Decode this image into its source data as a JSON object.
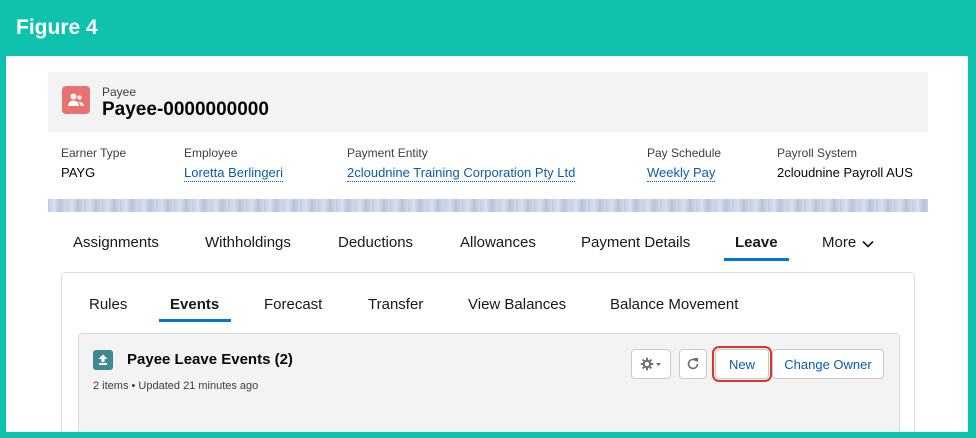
{
  "figure": {
    "title": "Figure 4"
  },
  "record": {
    "object_type": "Payee",
    "name": "Payee-0000000000",
    "icon": "payee-icon"
  },
  "highlights": [
    {
      "label": "Earner Type",
      "value": "PAYG",
      "link": false
    },
    {
      "label": "Employee",
      "value": "Loretta Berlingeri",
      "link": true
    },
    {
      "label": "Payment Entity",
      "value": "2cloudnine Training Corporation Pty Ltd",
      "link": true
    },
    {
      "label": "Pay Schedule",
      "value": "Weekly Pay",
      "link": true
    },
    {
      "label": "Payroll System",
      "value": "2cloudnine Payroll AUS",
      "link": false
    }
  ],
  "main_tabs": {
    "items": [
      "Assignments",
      "Withholdings",
      "Deductions",
      "Allowances",
      "Payment Details",
      "Leave"
    ],
    "more_label": "More",
    "active": "Leave"
  },
  "sub_tabs": {
    "items": [
      "Rules",
      "Events",
      "Forecast",
      "Transfer",
      "View Balances",
      "Balance Movement"
    ],
    "active": "Events"
  },
  "related_list": {
    "title": "Payee Leave Events (2)",
    "meta": "2 items • Updated 21 minutes ago",
    "icon": "leave-event-icon",
    "buttons": {
      "settings_icon": "gear-icon",
      "refresh_icon": "refresh-icon",
      "new_label": "New",
      "change_owner_label": "Change Owner"
    }
  },
  "colors": {
    "frame": "#0fc2ad",
    "accent": "#0176d3",
    "link": "#0b5cab",
    "record_icon": "#e77270",
    "related_icon": "#3f8a91",
    "highlight_box": "#d6392b"
  }
}
